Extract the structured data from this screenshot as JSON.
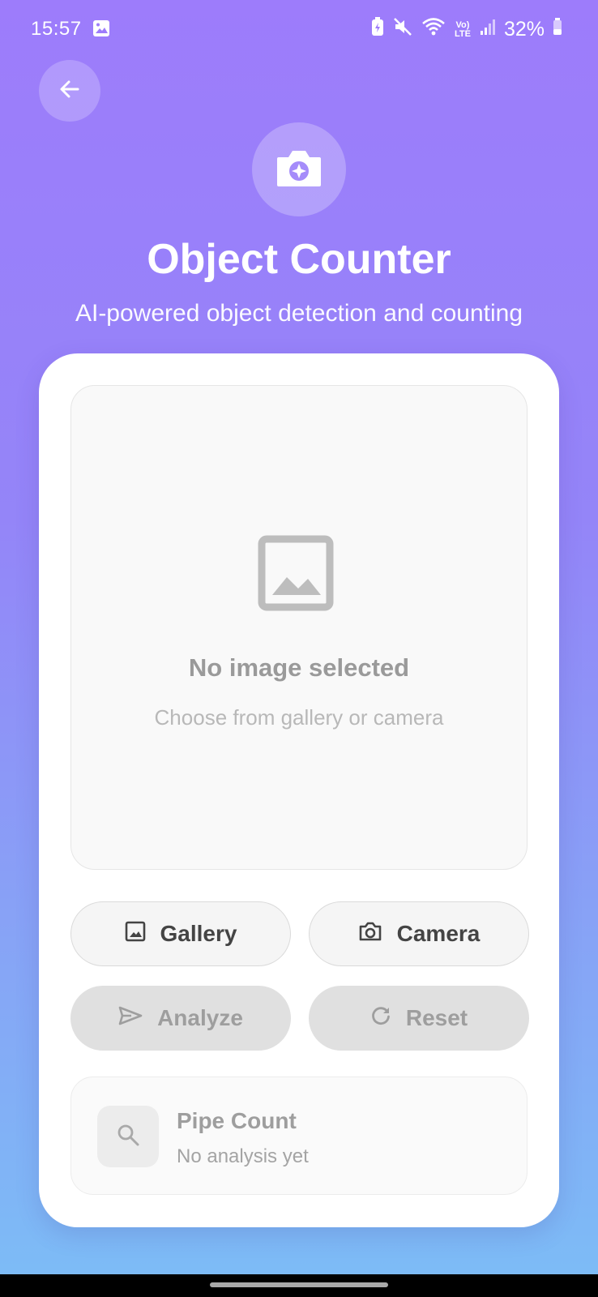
{
  "status_bar": {
    "time": "15:57",
    "network_label": "Vo) LTE",
    "battery": "32%"
  },
  "header": {
    "back_icon": "arrow-left-icon",
    "hero_icon": "camera-sparkle-icon",
    "title": "Object Counter",
    "subtitle": "AI-powered object detection and counting"
  },
  "image_area": {
    "placeholder_icon": "image-placeholder-icon",
    "title": "No image selected",
    "hint": "Choose from gallery or camera"
  },
  "actions": {
    "gallery": "Gallery",
    "camera": "Camera",
    "analyze": "Analyze",
    "reset": "Reset"
  },
  "result": {
    "icon": "search-icon",
    "title": "Pipe Count",
    "subtitle": "No analysis yet"
  },
  "colors": {
    "gradient_top": "#9d7cfb",
    "gradient_bottom": "#7cbdf6",
    "card": "#ffffff",
    "disabled_button": "#e0e0e0"
  }
}
